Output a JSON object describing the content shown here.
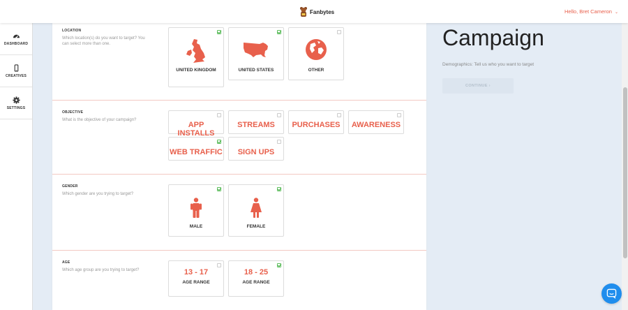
{
  "header": {
    "brand_name": "Fanbytes",
    "user_greeting": "Hello, Bret Cameron",
    "user_caret": "⌄"
  },
  "sidebar": {
    "items": [
      {
        "label": "DASHBOARD",
        "icon": "dashboard-icon"
      },
      {
        "label": "CREATIVES",
        "icon": "phone-icon"
      },
      {
        "label": "SETTINGS",
        "icon": "gear-icon"
      }
    ]
  },
  "location": {
    "title": "LOCATION",
    "description": "Which location(s) do you want to target? You can select more than one.",
    "options": [
      {
        "label": "UNITED KINGDOM",
        "checked": true,
        "icon": "uk-map-icon"
      },
      {
        "label": "UNITED STATES",
        "checked": true,
        "icon": "us-map-icon"
      },
      {
        "label": "OTHER",
        "checked": false,
        "icon": "globe-icon"
      }
    ]
  },
  "objective": {
    "title": "OBJECTIVE",
    "description": "What is the objective of your campaign?",
    "options": [
      {
        "label": "APP INSTALLS",
        "checked": false
      },
      {
        "label": "STREAMS",
        "checked": false
      },
      {
        "label": "PURCHASES",
        "checked": false
      },
      {
        "label": "AWARENESS",
        "checked": false
      },
      {
        "label": "WEB TRAFFIC",
        "checked": true
      },
      {
        "label": "SIGN UPS",
        "checked": false
      }
    ]
  },
  "gender": {
    "title": "GENDER",
    "description": "Which gender are you trying to target?",
    "options": [
      {
        "label": "MALE",
        "checked": true,
        "icon": "male-icon"
      },
      {
        "label": "FEMALE",
        "checked": true,
        "icon": "female-icon"
      }
    ]
  },
  "age": {
    "title": "AGE",
    "description": "Which age group are you trying to target?",
    "options": [
      {
        "range": "13 - 17",
        "sub": "AGE RANGE",
        "checked": false
      },
      {
        "range": "18 - 25",
        "sub": "AGE RANGE",
        "checked": true
      }
    ]
  },
  "panel": {
    "title": "Campaign",
    "description": "Demographics: Tell us who you want to target",
    "continue_label": "CONTINUE ›"
  },
  "colors": {
    "accent": "#e8604c",
    "check": "#3aa83a",
    "chat": "#1f8ded"
  }
}
